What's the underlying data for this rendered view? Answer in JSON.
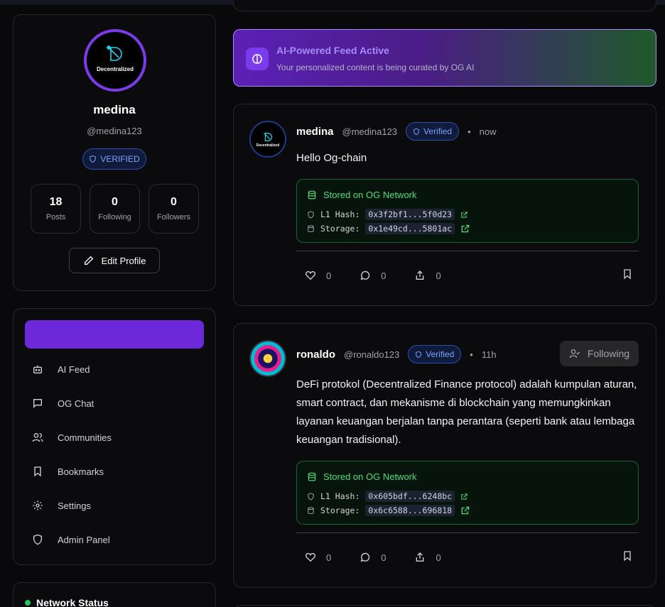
{
  "profile": {
    "avatar_text": "Decentralized",
    "name": "medina",
    "handle": "@medina123",
    "verified_label": "VERIFIED",
    "stats": [
      {
        "value": "18",
        "label": "Posts"
      },
      {
        "value": "0",
        "label": "Following"
      },
      {
        "value": "0",
        "label": "Followers"
      }
    ],
    "edit_label": "Edit Profile"
  },
  "nav": {
    "items": [
      {
        "label": "AI Feed",
        "icon": "bot-icon"
      },
      {
        "label": "OG Chat",
        "icon": "message-square-icon"
      },
      {
        "label": "Communities",
        "icon": "users-icon"
      },
      {
        "label": "Bookmarks",
        "icon": "bookmark-icon"
      },
      {
        "label": "Settings",
        "icon": "gear-icon"
      },
      {
        "label": "Admin Panel",
        "icon": "shield-icon"
      }
    ]
  },
  "network": {
    "title": "Network Status",
    "status_color": "#22c55e"
  },
  "ai_banner": {
    "title": "AI-Powered Feed Active",
    "subtitle": "Your personalized content is being curated by OG AI"
  },
  "posts": [
    {
      "avatar_text": "Decentralized",
      "name": "medina",
      "handle": "@medina123",
      "verified": "Verified",
      "separator": "•",
      "time": "now",
      "body": "Hello Og-chain",
      "storage": {
        "title": "Stored on OG Network",
        "l1_label": "L1 Hash:",
        "l1_hash": "0x3f2bf1...5f0d23",
        "storage_label": "Storage:",
        "storage_hash": "0x1e49cd...5801ac"
      },
      "likes": "0",
      "comments": "0",
      "shares": "0"
    },
    {
      "name": "ronaldo",
      "handle": "@ronaldo123",
      "verified": "Verified",
      "separator": "•",
      "time": "11h",
      "follow_label": "Following",
      "body": "DeFi protokol (Decentralized Finance protocol) adalah kumpulan aturan, smart contract, dan mekanisme di blockchain yang memungkinkan layanan keuangan berjalan tanpa perantara (seperti bank atau lembaga keuangan tradisional).",
      "storage": {
        "title": "Stored on OG Network",
        "l1_label": "L1 Hash:",
        "l1_hash": "0x605bdf...6248bc",
        "storage_label": "Storage:",
        "storage_hash": "0x6c6588...696818"
      },
      "likes": "0",
      "comments": "0",
      "shares": "0"
    }
  ],
  "colors": {
    "accent": "#6d28d9",
    "verified": "#7ea2ff",
    "storage_green": "#4ade80"
  }
}
